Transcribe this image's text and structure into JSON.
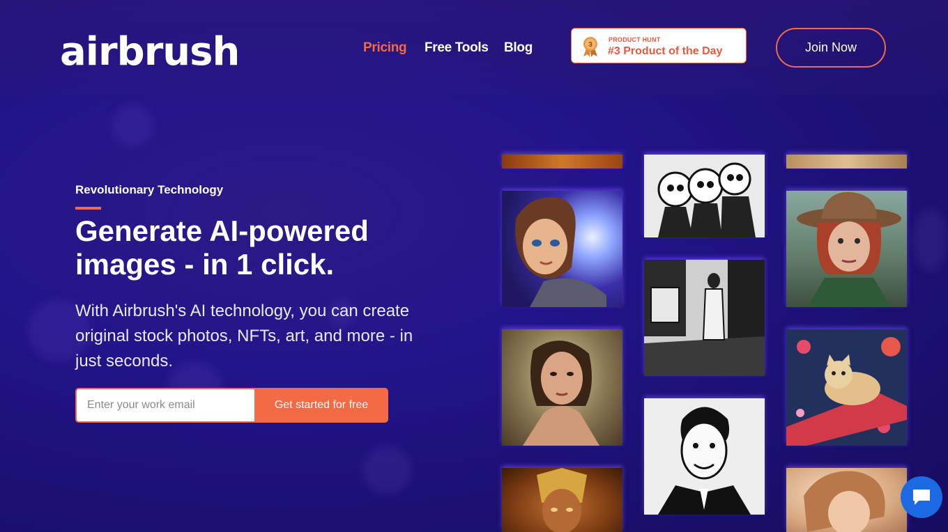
{
  "header": {
    "logo": "airbrush",
    "nav": {
      "pricing": "Pricing",
      "free_tools": "Free Tools",
      "blog": "Blog"
    },
    "badge": {
      "small": "PRODUCT HUNT",
      "big": "#3 Product of the Day",
      "medal_number": "3"
    },
    "join_label": "Join Now"
  },
  "hero": {
    "eyebrow": "Revolutionary Technology",
    "headline": "Generate AI-powered images - in 1 click.",
    "subtext": "With Airbrush's AI technology, you can create original stock photos, NFTs, art, and more - in just seconds.",
    "email_placeholder": "Enter your work email",
    "cta_label": "Get started for free"
  },
  "gallery": {
    "tiles": [
      {
        "name": "gallery-image-fire-top"
      },
      {
        "name": "gallery-image-cartoon-heroine"
      },
      {
        "name": "gallery-image-woman-portrait"
      },
      {
        "name": "gallery-image-golden-warrior"
      },
      {
        "name": "gallery-image-comic-kids"
      },
      {
        "name": "gallery-image-manga-room"
      },
      {
        "name": "gallery-image-ink-man-portrait"
      },
      {
        "name": "gallery-image-tan-top"
      },
      {
        "name": "gallery-image-hat-woman"
      },
      {
        "name": "gallery-image-cat-painting"
      },
      {
        "name": "gallery-image-woman-soft"
      }
    ]
  },
  "colors": {
    "accent": "#f26a4b",
    "background": "#1f1280",
    "chat": "#1c6ae3"
  }
}
